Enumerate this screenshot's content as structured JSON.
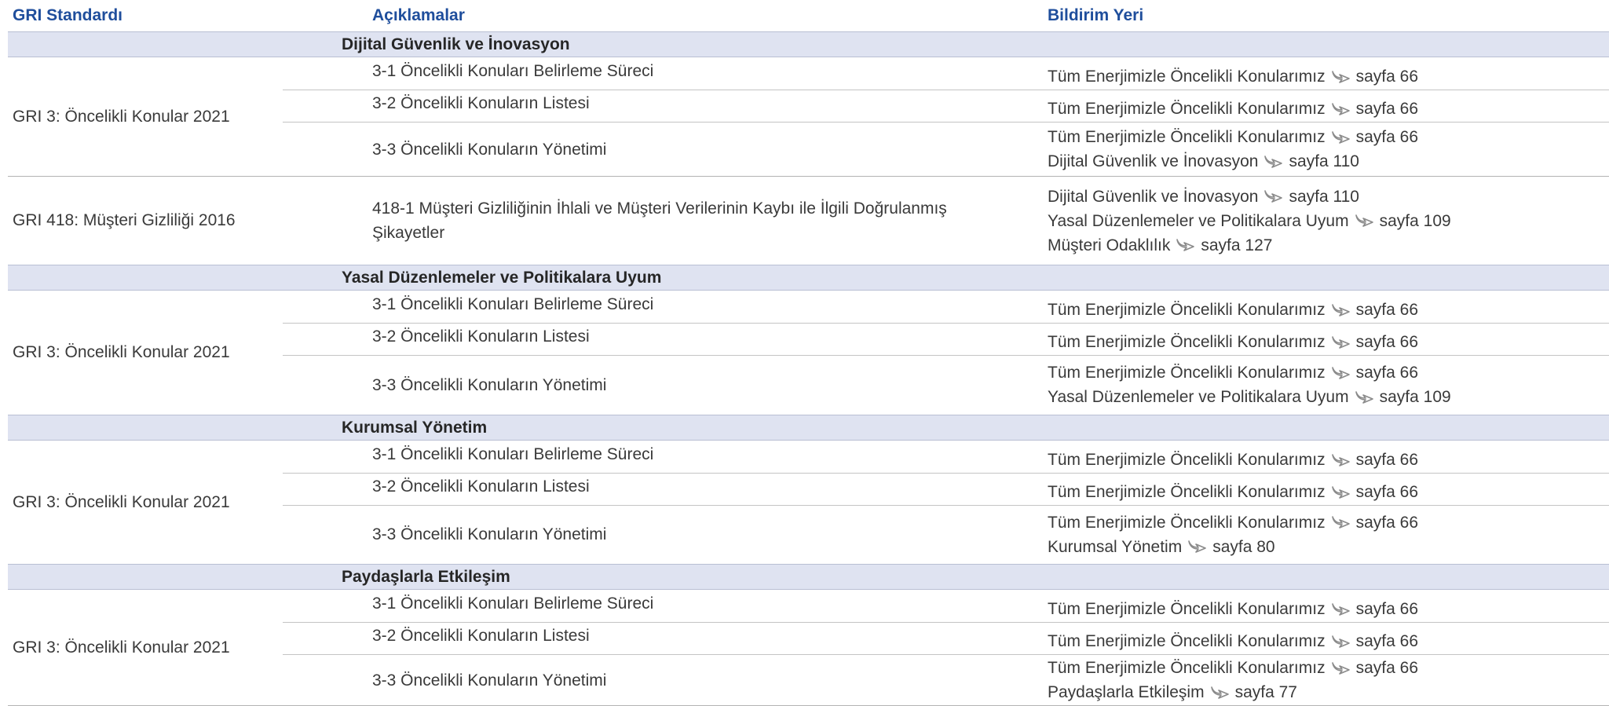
{
  "columns": {
    "standard": "GRI Standardı",
    "disclosures": "Açıklamalar",
    "location": "Bildirim Yeri"
  },
  "arrow_icon": "pointer-arrow-icon",
  "colors": {
    "header_text": "#1f4e9c",
    "band_bg": "#dfe3f1"
  },
  "sections": [
    {
      "title": "Dijital Güvenlik ve İnovasyon",
      "groups": [
        {
          "standard": "GRI 3: Öncelikli Konular 2021",
          "rows": [
            {
              "disclosure": "3-1 Öncelikli Konuları Belirleme Süreci",
              "refs": [
                {
                  "text": "Tüm Enerjimizle Öncelikli Konularımız",
                  "page": "sayfa 66"
                }
              ]
            },
            {
              "disclosure": "3-2 Öncelikli Konuların Listesi",
              "refs": [
                {
                  "text": "Tüm Enerjimizle Öncelikli Konularımız",
                  "page": "sayfa 66"
                }
              ]
            },
            {
              "disclosure": "3-3 Öncelikli Konuların Yönetimi",
              "refs": [
                {
                  "text": "Tüm Enerjimizle Öncelikli Konularımız",
                  "page": "sayfa 66"
                },
                {
                  "text": "Dijital Güvenlik ve İnovasyon",
                  "page": "sayfa 110"
                }
              ]
            }
          ]
        },
        {
          "standard": "GRI 418: Müşteri Gizliliği 2016",
          "rows": [
            {
              "disclosure": "418-1 Müşteri Gizliliğinin İhlali ve Müşteri Verilerinin Kaybı ile İlgili Doğrulanmış Şikayetler",
              "refs": [
                {
                  "text": "Dijital Güvenlik ve İnovasyon",
                  "page": "sayfa 110"
                },
                {
                  "text": "Yasal Düzenlemeler ve Politikalara Uyum",
                  "page": "sayfa 109"
                },
                {
                  "text": "Müşteri Odaklılık",
                  "page": "sayfa 127"
                }
              ]
            }
          ]
        }
      ]
    },
    {
      "title": "Yasal Düzenlemeler ve Politikalara Uyum",
      "groups": [
        {
          "standard": "GRI 3: Öncelikli Konular 2021",
          "rows": [
            {
              "disclosure": "3-1 Öncelikli Konuları Belirleme Süreci",
              "refs": [
                {
                  "text": "Tüm Enerjimizle Öncelikli Konularımız",
                  "page": "sayfa 66"
                }
              ]
            },
            {
              "disclosure": "3-2 Öncelikli Konuların Listesi",
              "refs": [
                {
                  "text": "Tüm Enerjimizle Öncelikli Konularımız",
                  "page": "sayfa 66"
                }
              ]
            },
            {
              "disclosure": "3-3 Öncelikli Konuların Yönetimi",
              "refs": [
                {
                  "text": "Tüm Enerjimizle Öncelikli Konularımız",
                  "page": "sayfa 66"
                },
                {
                  "text": "Yasal Düzenlemeler ve Politikalara Uyum",
                  "page": "sayfa 109"
                }
              ]
            }
          ]
        }
      ]
    },
    {
      "title": "Kurumsal Yönetim",
      "groups": [
        {
          "standard": "GRI 3: Öncelikli Konular 2021",
          "rows": [
            {
              "disclosure": "3-1 Öncelikli Konuları Belirleme Süreci",
              "refs": [
                {
                  "text": "Tüm Enerjimizle Öncelikli Konularımız",
                  "page": "sayfa 66"
                }
              ]
            },
            {
              "disclosure": "3-2 Öncelikli Konuların Listesi",
              "refs": [
                {
                  "text": "Tüm Enerjimizle Öncelikli Konularımız",
                  "page": "sayfa 66"
                }
              ]
            },
            {
              "disclosure": "3-3 Öncelikli Konuların Yönetimi",
              "refs": [
                {
                  "text": "Tüm Enerjimizle Öncelikli Konularımız",
                  "page": "sayfa 66"
                },
                {
                  "text": "Kurumsal Yönetim",
                  "page": "sayfa 80"
                }
              ]
            }
          ]
        }
      ]
    },
    {
      "title": "Paydaşlarla Etkileşim",
      "groups": [
        {
          "standard": "GRI 3: Öncelikli Konular 2021",
          "rows": [
            {
              "disclosure": "3-1 Öncelikli Konuları Belirleme Süreci",
              "refs": [
                {
                  "text": "Tüm Enerjimizle Öncelikli Konularımız",
                  "page": "sayfa 66"
                }
              ]
            },
            {
              "disclosure": "3-2 Öncelikli Konuların Listesi",
              "refs": [
                {
                  "text": "Tüm Enerjimizle Öncelikli Konularımız",
                  "page": "sayfa 66"
                }
              ]
            },
            {
              "disclosure": "3-3 Öncelikli Konuların Yönetimi",
              "refs": [
                {
                  "text": "Tüm Enerjimizle Öncelikli Konularımız",
                  "page": "sayfa 66"
                },
                {
                  "text": "Paydaşlarla Etkileşim",
                  "page": "sayfa 77"
                }
              ]
            }
          ]
        }
      ]
    }
  ]
}
